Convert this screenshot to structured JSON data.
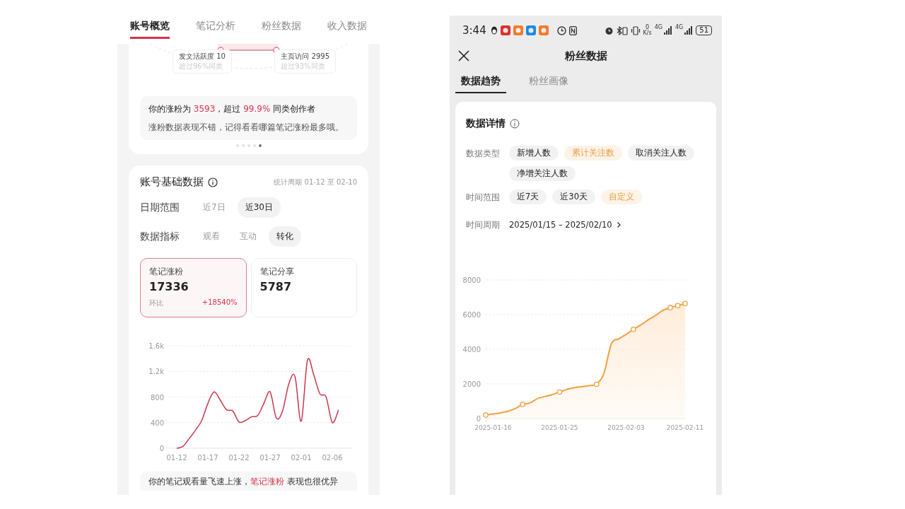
{
  "left_screen": {
    "tabs": [
      {
        "label": "账号概览",
        "selected": true
      },
      {
        "label": "笔记分析",
        "selected": false
      },
      {
        "label": "粉丝数据",
        "selected": false
      },
      {
        "label": "收入数据",
        "selected": false
      }
    ],
    "radar_stats": [
      {
        "label": "发文活跃度 10",
        "note": "超过96%同类"
      },
      {
        "label": "主页访问 2995",
        "note": "超过93%同类"
      }
    ],
    "summary": {
      "headline": [
        {
          "text": "你的涨粉为 ",
          "highlight": false
        },
        {
          "text": "3593",
          "highlight": true
        },
        {
          "text": "，超过 ",
          "highlight": false
        },
        {
          "text": "99.9%",
          "highlight": true
        },
        {
          "text": " 同类创作者",
          "highlight": false
        }
      ],
      "body": "涨粉数据表现不错，记得看看哪篇笔记涨粉最多哦。",
      "pages": [
        {
          "selected": false
        },
        {
          "selected": false
        },
        {
          "selected": false
        },
        {
          "selected": false
        },
        {
          "selected": true
        }
      ]
    },
    "basic": {
      "title": "账号基础数据",
      "period": "统计周期 01-12 至 02-10",
      "filters": [
        {
          "label": "日期范围",
          "options": [
            {
              "label": "近7日",
              "selected": false
            },
            {
              "label": "近30日",
              "selected": true
            }
          ]
        },
        {
          "label": "数据指标",
          "options": [
            {
              "label": "观看",
              "selected": false
            },
            {
              "label": "互动",
              "selected": false
            },
            {
              "label": "转化",
              "selected": true
            }
          ]
        }
      ],
      "metrics": [
        {
          "label": "笔记涨粉",
          "value": "17336",
          "compare_label": "环比",
          "compare_value": "+18540%",
          "selected": true
        },
        {
          "label": "笔记分享",
          "value": "5787",
          "selected": false
        }
      ],
      "chart_data": {
        "type": "line",
        "categories": [
          "01-12",
          null,
          null,
          null,
          null,
          "01-17",
          null,
          null,
          null,
          null,
          "01-22",
          null,
          null,
          null,
          null,
          "01-27",
          null,
          null,
          null,
          null,
          "02-01",
          null,
          null,
          null,
          null,
          "02-06",
          null
        ],
        "grid": true,
        "series": [
          {
            "color": "#c8374f",
            "values": [
              0,
              30,
              150,
              280,
              430,
              700,
              880,
              750,
              600,
              580,
              410,
              430,
              490,
              510,
              700,
              880,
              470,
              580,
              1000,
              1120,
              420,
              1370,
              1150,
              850,
              800,
              400,
              600
            ]
          }
        ],
        "ylim": [
          0,
          1600
        ],
        "yticks": [
          {
            "value": 0,
            "label": "0"
          },
          {
            "value": 400,
            "label": "400"
          },
          {
            "value": 800,
            "label": "800"
          },
          {
            "value": 1200,
            "label": "1.2k"
          },
          {
            "value": 1600,
            "label": "1.6k"
          }
        ]
      },
      "insight": [
        {
          "text": "你的笔记观看量飞速上涨，",
          "highlight": false
        },
        {
          "text": "笔记涨粉",
          "highlight": true
        },
        {
          "text": " 表现也很优异",
          "highlight": false
        }
      ]
    }
  },
  "right_screen": {
    "status_bar": {
      "time": "3:44",
      "speed_value": "0",
      "speed_unit": "K/s",
      "network_1": "4G",
      "network_2": "4G",
      "battery": "51"
    },
    "header": {
      "title": "粉丝数据"
    },
    "tabs": [
      {
        "label": "数据趋势",
        "selected": true
      },
      {
        "label": "粉丝画像",
        "selected": false
      }
    ],
    "details": {
      "title": "数据详情",
      "filters": [
        {
          "label": "数据类型",
          "options": [
            {
              "label": "新增人数",
              "selected": false
            },
            {
              "label": "累计关注数",
              "selected": true
            },
            {
              "label": "取消关注人数",
              "selected": false
            },
            {
              "label": "净增关注人数",
              "selected": false
            }
          ]
        },
        {
          "label": "时间范围",
          "options": [
            {
              "label": "近7天",
              "selected": false
            },
            {
              "label": "近30天",
              "selected": false
            },
            {
              "label": "自定义",
              "selected": true
            }
          ]
        }
      ],
      "period_label": "时间周期",
      "period_value": "2025/01/15 – 2025/02/10",
      "chart_data": {
        "type": "area",
        "categories": [
          null,
          "2025-01-16",
          null,
          null,
          null,
          null,
          null,
          null,
          null,
          null,
          "2025-01-25",
          null,
          null,
          null,
          null,
          null,
          null,
          null,
          null,
          "2025-02-03",
          null,
          null,
          null,
          null,
          null,
          null,
          null,
          "2025-02-11"
        ],
        "grid": true,
        "series": [
          {
            "color": "#f0a040",
            "values": [
              200,
              260,
              330,
              420,
              580,
              820,
              900,
              1150,
              1270,
              1380,
              1530,
              1680,
              1780,
              1840,
              1900,
              1980,
              2600,
              4300,
              4600,
              4850,
              5150,
              5400,
              5700,
              5950,
              6250,
              6400,
              6520,
              6640
            ]
          }
        ],
        "ylim": [
          0,
          8000
        ],
        "yticks": [
          0,
          2000,
          4000,
          6000,
          8000
        ]
      }
    }
  }
}
